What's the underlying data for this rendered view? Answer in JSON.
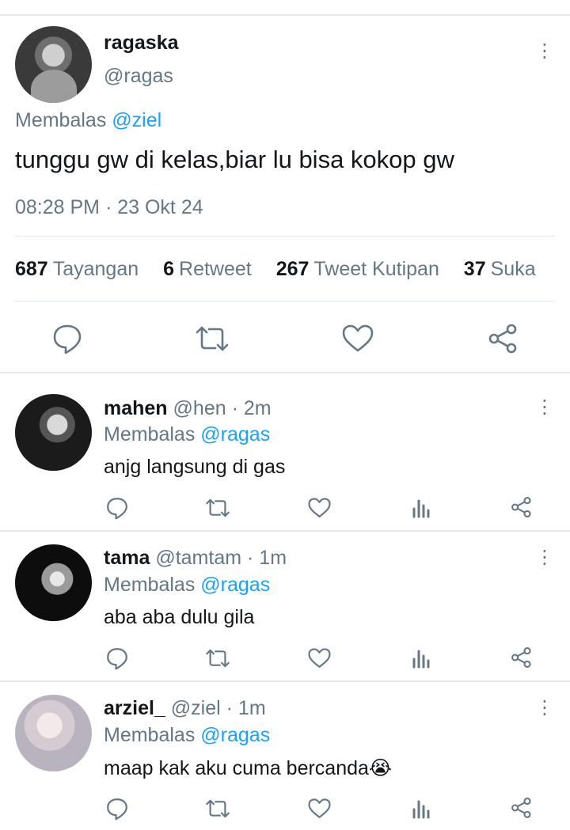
{
  "main_tweet": {
    "name": "ragaska",
    "handle": "@ragas",
    "reply_prefix": "Membalas",
    "reply_to": "@ziel",
    "text": "tunggu gw di kelas,biar lu bisa kokop gw",
    "timestamp": "08:28 PM · 23 Okt 24",
    "stats": [
      {
        "count": "687",
        "label": "Tayangan"
      },
      {
        "count": "6",
        "label": "Retweet"
      },
      {
        "count": "267",
        "label": "Tweet Kutipan"
      },
      {
        "count": "37",
        "label": "Suka"
      }
    ],
    "actions": [
      "reply-icon",
      "retweet-icon",
      "like-icon",
      "share-icon"
    ]
  },
  "replies": [
    {
      "name": "mahen",
      "handle": "@hen",
      "time": "· 2m",
      "reply_prefix": "Membalas",
      "reply_to": "@ragas",
      "text": "anjg langsung di gas"
    },
    {
      "name": "tama",
      "handle": "@tamtam",
      "time": "· 1m",
      "reply_prefix": "Membalas",
      "reply_to": "@ragas",
      "text": "aba aba dulu gila"
    },
    {
      "name": "arziel_",
      "handle": "@ziel",
      "time": "· 1m",
      "reply_prefix": "Membalas",
      "reply_to": "@ragas",
      "text": "maap kak aku cuma bercanda😭"
    }
  ],
  "reply_actions": [
    "reply-icon",
    "retweet-icon",
    "like-icon",
    "analytics-icon",
    "share-icon"
  ],
  "colors": {
    "accent": "#1da1f2",
    "secondary_text": "#657786",
    "primary_text": "#14171a",
    "divider": "#e1e8ed"
  }
}
